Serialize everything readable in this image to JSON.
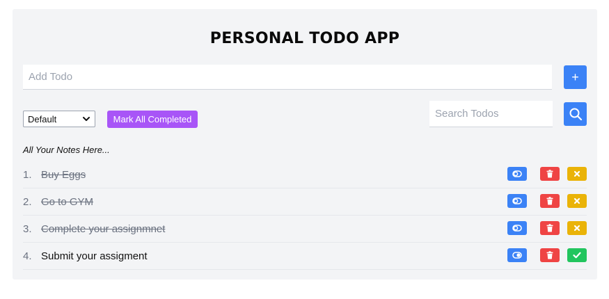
{
  "app": {
    "title": "PERSONAL TODO APP"
  },
  "add": {
    "placeholder": "Add Todo",
    "button_label": "+"
  },
  "filter": {
    "selected": "Default"
  },
  "actions": {
    "mark_all_label": "Mark All Completed"
  },
  "search": {
    "placeholder": "Search Todos"
  },
  "list": {
    "heading": "All Your Notes Here...",
    "items": [
      {
        "number": "1.",
        "text": "Buy Eggs",
        "completed": true
      },
      {
        "number": "2.",
        "text": "Go to GYM",
        "completed": true
      },
      {
        "number": "3.",
        "text": "Complete your assignmnet",
        "completed": true
      },
      {
        "number": "4.",
        "text": "Submit your assigment",
        "completed": false
      }
    ]
  },
  "icons": {
    "toggle": "toggle-icon",
    "delete": "trash-icon",
    "pending": "x-icon",
    "complete": "check-icon",
    "search": "search-icon"
  },
  "colors": {
    "primary": "#3b82f6",
    "purple": "#a855f7",
    "danger": "#ef4444",
    "warning": "#eab308",
    "success": "#22c55e"
  }
}
